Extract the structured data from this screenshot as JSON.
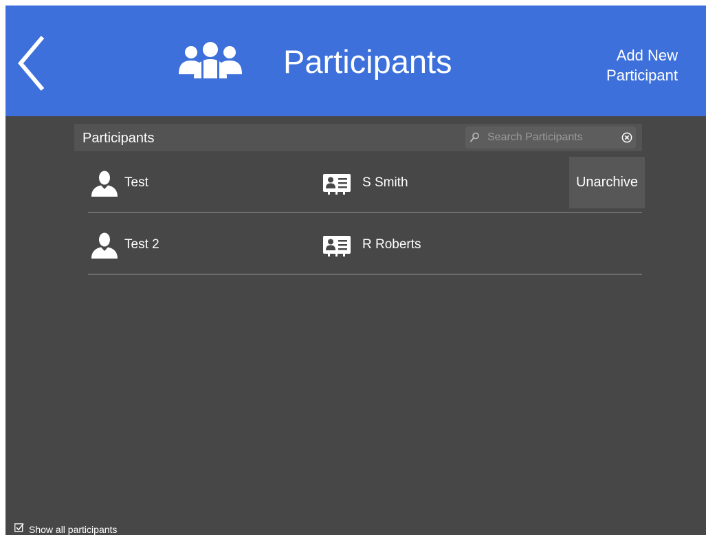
{
  "header": {
    "title": "Participants",
    "add_button_line1": "Add New",
    "add_button_line2": "Participant",
    "header_icon": "group-icon",
    "back_icon": "chevron-left-icon"
  },
  "list": {
    "header_label": "Participants",
    "search": {
      "placeholder": "Search Participants",
      "value": ""
    },
    "rows": [
      {
        "name": "Test",
        "contact": "S Smith",
        "action_label": "Unarchive"
      },
      {
        "name": "Test 2",
        "contact": "R Roberts"
      }
    ]
  },
  "footer": {
    "show_all_label": "Show all participants",
    "show_all_checked": true
  },
  "colors": {
    "header_bg": "#3d70db",
    "app_bg": "#474747",
    "list_header_bg": "#535353",
    "search_bg": "#5d5d5d",
    "action_bg": "#575757",
    "text": "#ffffff"
  }
}
